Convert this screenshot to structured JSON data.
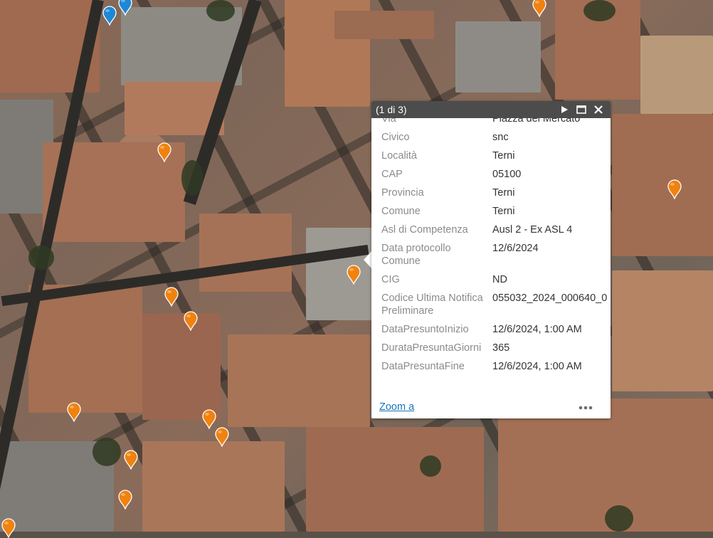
{
  "popup": {
    "title": "(1 di 3)",
    "attributes": [
      {
        "label": "Via",
        "value": "Piazza del Mercato"
      },
      {
        "label": "Civico",
        "value": "snc"
      },
      {
        "label": "Località",
        "value": "Terni"
      },
      {
        "label": "CAP",
        "value": "05100"
      },
      {
        "label": "Provincia",
        "value": "Terni"
      },
      {
        "label": "Comune",
        "value": "Terni"
      },
      {
        "label": "Asl di Competenza",
        "value": "Ausl 2 - Ex ASL 4"
      },
      {
        "label": "Data protocollo Comune",
        "value": "12/6/2024"
      },
      {
        "label": "CIG",
        "value": "ND"
      },
      {
        "label": "Codice Ultima Notifica Preliminare",
        "value": "055032_2024_000640_0"
      },
      {
        "label": "DataPresuntoInizio",
        "value": "12/6/2024, 1:00 AM"
      },
      {
        "label": "DurataPresuntaGiorni",
        "value": "365"
      },
      {
        "label": "DataPresuntaFine",
        "value": "12/6/2024, 1:00 AM"
      }
    ],
    "zoom_label": "Zoom a",
    "icons": {
      "next": "play-icon",
      "maximize": "maximize-icon",
      "close": "close-icon",
      "more": "more-icon"
    }
  },
  "colors": {
    "marker_orange": "#f0820f",
    "marker_blue": "#1e88d8",
    "header_bg": "#4c4c4c",
    "link": "#1a73b8"
  }
}
